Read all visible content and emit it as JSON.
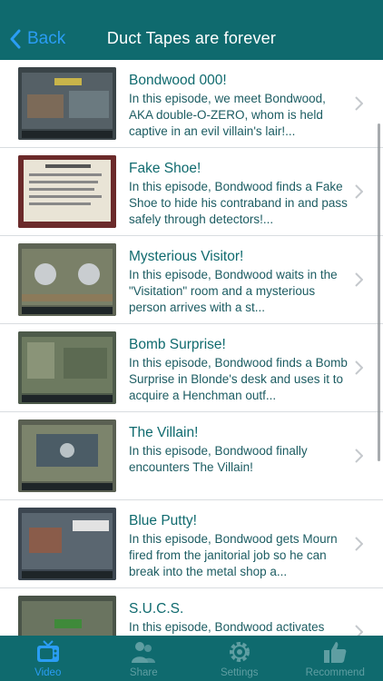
{
  "nav": {
    "back_label": "Back",
    "title": "Duct Tapes are forever"
  },
  "episodes": [
    {
      "title": "Bondwood 000!",
      "description": "In this episode, we meet Bondwood, AKA double-O-ZERO, whom is held captive in an evil villain's lair!..."
    },
    {
      "title": "Fake Shoe!",
      "description": "In this episode, Bondwood finds a Fake Shoe to hide his contraband in and pass safely through detectors!..."
    },
    {
      "title": "Mysterious Visitor!",
      "description": "In this episode, Bondwood waits in the \"Visitation\" room and a mysterious person arrives with a st..."
    },
    {
      "title": "Bomb Surprise!",
      "description": "In this episode, Bondwood finds a Bomb Surprise in Blonde's desk and uses it to acquire a Henchman outf..."
    },
    {
      "title": "The Villain!",
      "description": "In this episode, Bondwood finally encounters The Villain!"
    },
    {
      "title": "Blue Putty!",
      "description": "In this episode, Bondwood gets Mourn fired from the janitorial job so he can break into the metal shop a..."
    },
    {
      "title": "S.U.C.S.",
      "description": "In this episode, Bondwood activates"
    }
  ],
  "tabs": [
    {
      "label": "Video",
      "icon": "tv-icon",
      "active": true
    },
    {
      "label": "Share",
      "icon": "people-icon",
      "active": false
    },
    {
      "label": "Settings",
      "icon": "gear-icon",
      "active": false
    },
    {
      "label": "Recommend",
      "icon": "thumbs-up-icon",
      "active": false
    }
  ],
  "colors": {
    "bar": "#0f6a6e",
    "accent": "#2a9df4",
    "title_text": "#0f6a6e",
    "desc_text": "#1c5c62"
  }
}
